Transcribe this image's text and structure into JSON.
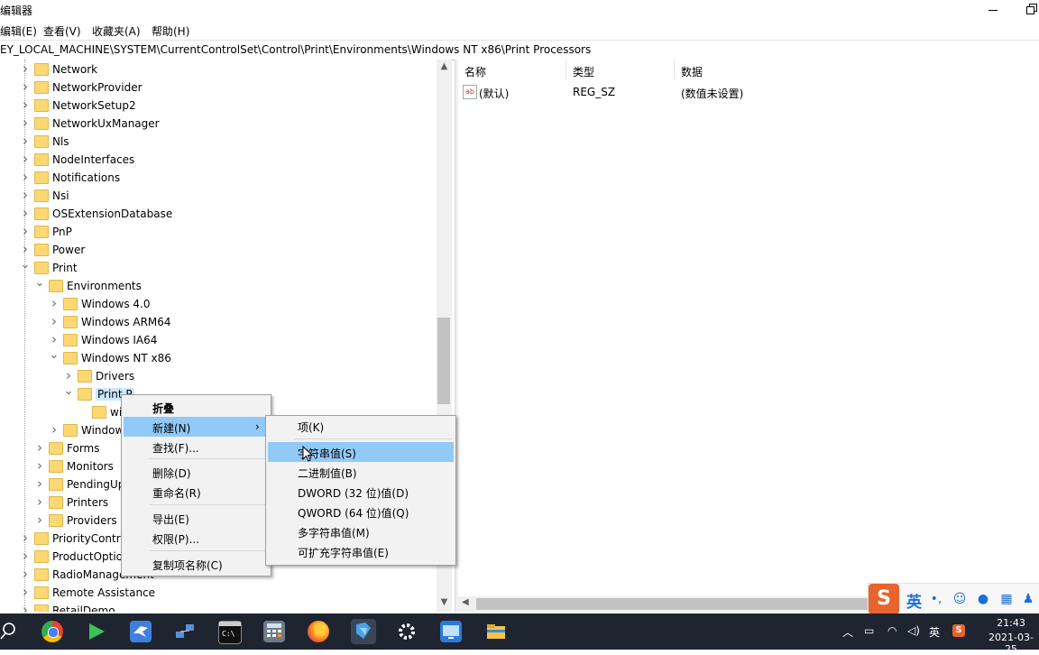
{
  "window": {
    "title": "编辑器",
    "menus": [
      "编辑(E)",
      "查看(V)",
      "收藏夹(A)",
      "帮助(H)"
    ],
    "address": "EY_LOCAL_MACHINE\\SYSTEM\\CurrentControlSet\\Control\\Print\\Environments\\Windows NT x86\\Print Processors"
  },
  "tree": {
    "items": [
      {
        "label": "Network",
        "level": 1,
        "expander": ">"
      },
      {
        "label": "NetworkProvider",
        "level": 1,
        "expander": ">"
      },
      {
        "label": "NetworkSetup2",
        "level": 1,
        "expander": ">"
      },
      {
        "label": "NetworkUxManager",
        "level": 1,
        "expander": ">"
      },
      {
        "label": "Nls",
        "level": 1,
        "expander": ">"
      },
      {
        "label": "NodeInterfaces",
        "level": 1,
        "expander": ">"
      },
      {
        "label": "Notifications",
        "level": 1,
        "expander": ">"
      },
      {
        "label": "Nsi",
        "level": 1,
        "expander": ">"
      },
      {
        "label": "OSExtensionDatabase",
        "level": 1,
        "expander": ">"
      },
      {
        "label": "PnP",
        "level": 1,
        "expander": ">"
      },
      {
        "label": "Power",
        "level": 1,
        "expander": ">"
      },
      {
        "label": "Print",
        "level": 1,
        "expander": "v"
      },
      {
        "label": "Environments",
        "level": 2,
        "expander": "v"
      },
      {
        "label": "Windows 4.0",
        "level": 3,
        "expander": ">"
      },
      {
        "label": "Windows ARM64",
        "level": 3,
        "expander": ">"
      },
      {
        "label": "Windows IA64",
        "level": 3,
        "expander": ">"
      },
      {
        "label": "Windows NT x86",
        "level": 3,
        "expander": "v"
      },
      {
        "label": "Drivers",
        "level": 4,
        "expander": ">"
      },
      {
        "label": "Print P",
        "level": 4,
        "expander": "v",
        "selected": true
      },
      {
        "label": "wi",
        "level": 5,
        "expander": ""
      },
      {
        "label": "Window",
        "level": 3,
        "expander": ">"
      },
      {
        "label": "Forms",
        "level": 2,
        "expander": ">"
      },
      {
        "label": "Monitors",
        "level": 2,
        "expander": ">"
      },
      {
        "label": "PendingUp",
        "level": 2,
        "expander": ">"
      },
      {
        "label": "Printers",
        "level": 2,
        "expander": ">"
      },
      {
        "label": "Providers",
        "level": 2,
        "expander": ">"
      },
      {
        "label": "PriorityContro",
        "level": 1,
        "expander": ">"
      },
      {
        "label": "ProductOptio",
        "level": 1,
        "expander": ">"
      },
      {
        "label": "RadioManagement",
        "level": 1,
        "expander": ">"
      },
      {
        "label": "Remote Assistance",
        "level": 1,
        "expander": ">"
      },
      {
        "label": "RetailDemo",
        "level": 1,
        "expander": ">"
      }
    ]
  },
  "list": {
    "columns": [
      "名称",
      "类型",
      "数据"
    ],
    "rows": [
      {
        "icon": "ab",
        "name": "(默认)",
        "type": "REG_SZ",
        "data": "(数值未设置)"
      }
    ]
  },
  "context_menu": {
    "items": [
      "折叠",
      "新建(N)",
      "查找(F)...",
      "删除(D)",
      "重命名(R)",
      "导出(E)",
      "权限(P)...",
      "复制项名称(C)"
    ]
  },
  "submenu": {
    "items": [
      "项(K)",
      "字符串值(S)",
      "二进制值(B)",
      "DWORD (32 位)值(D)",
      "QWORD (64 位)值(Q)",
      "多字符串值(M)",
      "可扩充字符串值(E)"
    ]
  },
  "taskbar": {
    "clock_time": "21:43",
    "clock_date": "2021-03-25",
    "ime_lang": "英",
    "tray_lang": "英",
    "ime_logo": "S",
    "icons": [
      "search-icon",
      "chrome-icon",
      "media-player-icon",
      "bird-app-icon",
      "network-app-icon",
      "terminal-icon",
      "calculator-icon",
      "firefox-icon",
      "regedit-icon",
      "settings-icon",
      "remote-desktop-icon",
      "file-explorer-icon"
    ],
    "colors": {
      "taskbar": "#1f2530",
      "highlight": "#91c9f7",
      "selection": "#cce8ff"
    }
  }
}
